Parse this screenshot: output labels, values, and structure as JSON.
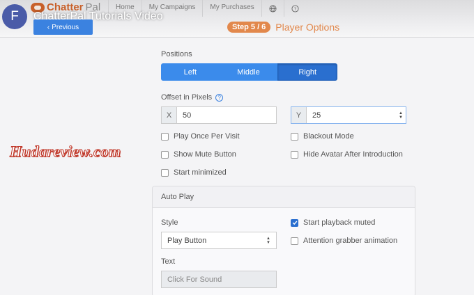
{
  "header": {
    "logo": {
      "brand_a": "Chatter",
      "brand_b": "Pal"
    },
    "nav": [
      "Home",
      "My Campaigns",
      "My Purchases"
    ],
    "nav_icons": [
      "globe-icon",
      "help-icon"
    ]
  },
  "video": {
    "avatar_letter": "F",
    "title": "ChatterPal Tutorials Video"
  },
  "wizard": {
    "previous_label": "Previous",
    "step_label": "Step 5 / 6",
    "step_title": "Player Options"
  },
  "watermark": "Hudareview.com",
  "positions": {
    "label": "Positions",
    "options": [
      "Left",
      "Middle",
      "Right"
    ],
    "selected": "Right"
  },
  "offset": {
    "label": "Offset in Pixels",
    "x_label": "X",
    "x_value": "50",
    "y_label": "Y",
    "y_value": "25"
  },
  "options": [
    {
      "label": "Play Once Per Visit",
      "checked": false
    },
    {
      "label": "Blackout Mode",
      "checked": false
    },
    {
      "label": "Show Mute Button",
      "checked": false
    },
    {
      "label": "Hide Avatar After Introduction",
      "checked": false
    },
    {
      "label": "Start minimized",
      "checked": false
    }
  ],
  "autoplay": {
    "title": "Auto Play",
    "style_label": "Style",
    "style_value": "Play Button",
    "text_label": "Text",
    "text_placeholder": "Click For Sound",
    "start_muted_label": "Start playback muted",
    "start_muted_checked": true,
    "attention_label": "Attention grabber animation",
    "attention_checked": false
  },
  "colors": {
    "primary": "#3b8beb",
    "primary_active": "#2a6fcf",
    "accent": "#e2884c",
    "avatar": "#4a5ba8"
  }
}
